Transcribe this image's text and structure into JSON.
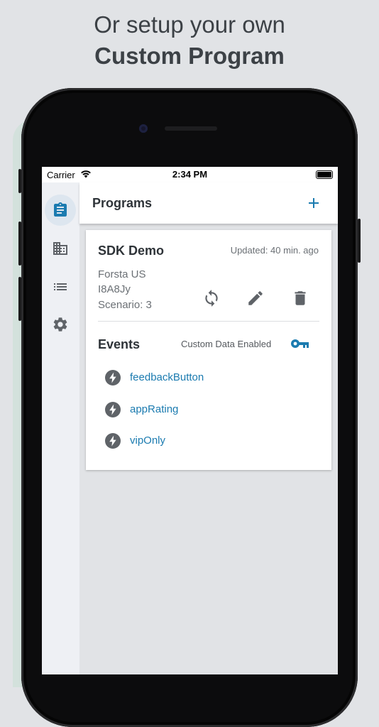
{
  "headline": {
    "line1": "Or setup your own",
    "line2": "Custom Program"
  },
  "statusbar": {
    "carrier": "Carrier",
    "time": "2:34 PM"
  },
  "rail": {
    "items": [
      {
        "icon": "clipboard-icon",
        "active": true
      },
      {
        "icon": "building-icon",
        "active": false
      },
      {
        "icon": "list-icon",
        "active": false
      },
      {
        "icon": "gear-icon",
        "active": false
      }
    ]
  },
  "header": {
    "title": "Programs",
    "add_icon": "plus-icon"
  },
  "program": {
    "name": "SDK Demo",
    "updated": "Updated: 40 min. ago",
    "region": "Forsta US",
    "id": "I8A8Jy",
    "scenario": "Scenario: 3",
    "actions": [
      "sync-icon",
      "edit-icon",
      "trash-icon"
    ]
  },
  "events": {
    "title": "Events",
    "custom_data": "Custom Data Enabled",
    "key_icon": "key-icon",
    "items": [
      {
        "label": "feedbackButton",
        "icon": "bolt-icon"
      },
      {
        "label": "appRating",
        "icon": "bolt-icon"
      },
      {
        "label": "vipOnly",
        "icon": "bolt-icon"
      }
    ]
  },
  "colors": {
    "accent": "#1b7bb0",
    "text_dark": "#2e3338",
    "text_muted": "#6b7075",
    "icon_grey": "#5f6368",
    "rail_bg": "#eef0f4",
    "page_bg": "#e1e3e6"
  }
}
